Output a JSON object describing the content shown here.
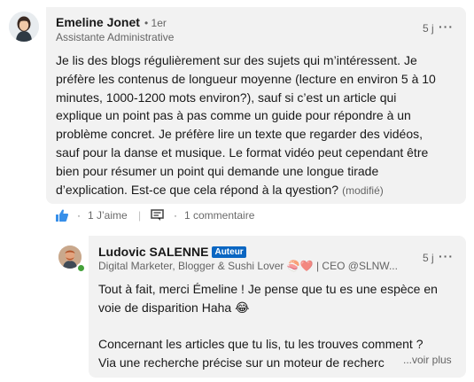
{
  "comment": {
    "author": "Emeline Jonet",
    "degree": "• 1er",
    "headline": "Assistante Administrative",
    "time": "5 j",
    "menu": "···",
    "body_lines": [
      "Je lis des blogs régulièrement sur des sujets qui m’intéressent. Je",
      "préfère les contenus de longueur moyenne (lecture en environ 5 à 10",
      "minutes, 1000-1200 mots environ?), sauf si c’est un article qui",
      "explique un point pas à pas comme un guide pour répondre à un",
      "problème concret. Je préfère lire un texte que regarder des vidéos,",
      "sauf pour la danse et musique. Le format vidéo peut cependant être",
      "bien pour résumer un point qui demande une longue tirade",
      "d’explication. Est-ce que cela répond à la qyestion?"
    ],
    "modified": "(modifié)",
    "likes": "1 J’aime",
    "replies": "1 commentaire",
    "separator": "·"
  },
  "reply": {
    "author": "Ludovic SALENNE",
    "badge": "Auteur",
    "headline": "Digital Marketer, Blogger & Sushi Lover 🍣❤️ | CEO @SLNW...",
    "time": "5 j",
    "menu": "···",
    "body_lines": [
      "Tout à fait, merci Émeline ! Je pense que tu es une espèce en",
      "voie de disparition Haha 😂",
      "",
      "Concernant les articles que tu lis, tu les trouves comment ?",
      "Via une recherche précise sur un moteur de recherc"
    ],
    "see_more": "...voir plus"
  },
  "colors": {
    "bubble": "#f2f2f2",
    "accent": "#0a66c2",
    "online": "#44a13a"
  },
  "icons": [
    "avatar-emeline",
    "avatar-ludovic",
    "like-icon",
    "comment-icon",
    "more-icon"
  ]
}
